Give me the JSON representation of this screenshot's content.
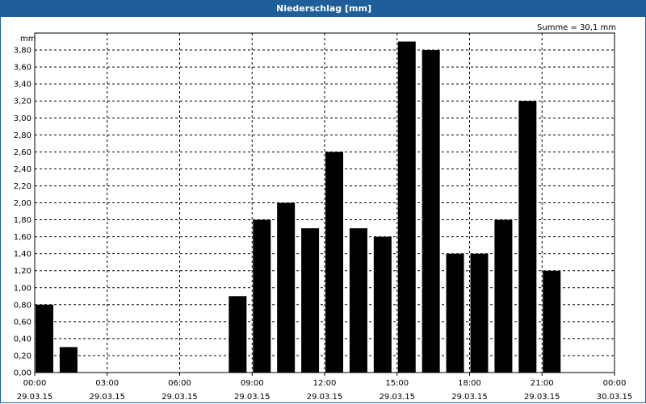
{
  "window_title": "Niederschlag [mm]",
  "chart_data": {
    "type": "bar",
    "title": "Niederschlag [mm]",
    "ylabel": "mm",
    "annotation": "Summe = 30,1 mm",
    "ylim": [
      0,
      4.0
    ],
    "y_ticks": [
      "0,00",
      "0,20",
      "0,40",
      "0,60",
      "0,80",
      "1,00",
      "1,20",
      "1,40",
      "1,60",
      "1,80",
      "2,00",
      "2,20",
      "2,40",
      "2,60",
      "2,80",
      "3,00",
      "3,20",
      "3,40",
      "3,60",
      "3,80"
    ],
    "x_ticks": [
      {
        "time": "00:00",
        "date": "29.03.15"
      },
      {
        "time": "03:00",
        "date": "29.03.15"
      },
      {
        "time": "06:00",
        "date": "29.03.15"
      },
      {
        "time": "09:00",
        "date": "29.03.15"
      },
      {
        "time": "12:00",
        "date": "29.03.15"
      },
      {
        "time": "15:00",
        "date": "29.03.15"
      },
      {
        "time": "18:00",
        "date": "29.03.15"
      },
      {
        "time": "21:00",
        "date": "29.03.15"
      },
      {
        "time": "00:00",
        "date": "30.03.15"
      }
    ],
    "categories": [
      "00:00",
      "01:00",
      "02:00",
      "03:00",
      "04:00",
      "05:00",
      "06:00",
      "07:00",
      "08:00",
      "09:00",
      "10:00",
      "11:00",
      "12:00",
      "13:00",
      "14:00",
      "15:00",
      "16:00",
      "17:00",
      "18:00",
      "19:00",
      "20:00",
      "21:00",
      "22:00",
      "23:00"
    ],
    "values": [
      0.8,
      0.3,
      0,
      0,
      0,
      0,
      0,
      0,
      0.9,
      1.8,
      2.0,
      1.7,
      2.6,
      1.7,
      1.6,
      3.9,
      3.8,
      1.4,
      1.4,
      1.8,
      3.2,
      1.2,
      0,
      0
    ],
    "bar_color": "#000000",
    "grid": true
  }
}
